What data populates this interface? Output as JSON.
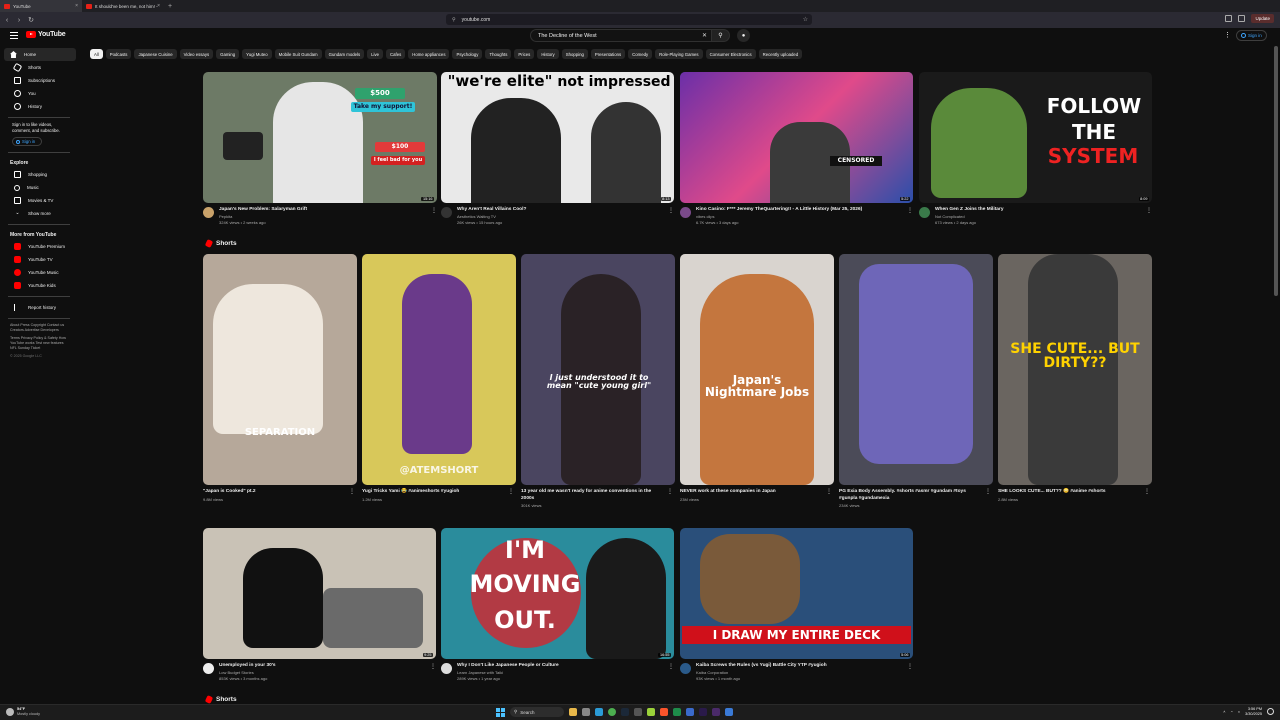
{
  "browser": {
    "tabs": [
      {
        "label": "YouTube"
      },
      {
        "label": "It should've been me, not him! - Yo..."
      }
    ],
    "url": "youtube.com",
    "update_label": "Update"
  },
  "header": {
    "logo_text": "YouTube",
    "search_value": "The Decline of the West",
    "signin_label": "Sign in"
  },
  "sidebar": {
    "main": [
      {
        "label": "Home",
        "icon": "home-icon"
      },
      {
        "label": "Shorts",
        "icon": "shorts-icon"
      },
      {
        "label": "Subscriptions",
        "icon": "subscriptions-icon"
      },
      {
        "label": "You",
        "icon": "you-icon"
      },
      {
        "label": "History",
        "icon": "history-icon"
      }
    ],
    "signin_text": "Sign in to like videos, comment, and subscribe.",
    "signin_button": "Sign in",
    "explore_title": "Explore",
    "explore": [
      {
        "label": "Shopping",
        "icon": "shopping-icon"
      },
      {
        "label": "Music",
        "icon": "music-icon"
      },
      {
        "label": "Movies & TV",
        "icon": "movies-icon"
      },
      {
        "label": "Show more",
        "icon": "chevron-down-icon"
      }
    ],
    "more_title": "More from YouTube",
    "more": [
      {
        "label": "YouTube Premium"
      },
      {
        "label": "YouTube TV"
      },
      {
        "label": "YouTube Music"
      },
      {
        "label": "YouTube Kids"
      }
    ],
    "report": "Report history",
    "footer1": "About Press Copyright Contact us Creators Advertise Developers",
    "footer2": "Terms Privacy Policy & Safety How YouTube works Test new features NFL Sunday Ticket",
    "copyright": "© 2025 Google LLC"
  },
  "chips": [
    "All",
    "Podcasts",
    "Japanese Cuisine",
    "Video essays",
    "Gaming",
    "Yugi Muteo",
    "Mobile Suit Gundam",
    "Gundam models",
    "Live",
    "Cafes",
    "Home appliances",
    "Psychology",
    "Thoughts",
    "Prices",
    "History",
    "Shopping",
    "Presentations",
    "Comedy",
    "Role-Playing Games",
    "Consumer Electronics",
    "Recently uploaded"
  ],
  "videos_row1": [
    {
      "title": "Japan's New Problem: Salaryman Grift",
      "channel": "Pepkita",
      "stats": "324K views • 2 weeks ago",
      "duration": "15:16",
      "av_color": "#c9a26a",
      "bg": "#6d7a66"
    },
    {
      "title": "Why Aren't Real Villains Cool?",
      "channel": "Aesthetics Waiting TV",
      "stats": "26K views • 15 hours ago",
      "duration": "8:13",
      "av_color": "#333",
      "bg": "#e9e9e9"
    },
    {
      "title": "Kino Casino: F*** Jeremy TheQuartering!! - A Little History (Mar 25, 2026)",
      "channel": "vibes clips",
      "stats": "6.7K views • 3 days ago",
      "duration": "5:22",
      "av_color": "#7a4a8a",
      "bg": "#3a3f8f"
    },
    {
      "title": "When Gen Z Joins the Military",
      "channel": "Not Complicated",
      "stats": "673 views • 2 days ago",
      "duration": "8:09",
      "av_color": "#3a7a4a",
      "bg": "#1a1a1a"
    }
  ],
  "overlay_text": {
    "v1_badge1": "$500",
    "v1_badge2": "Take my support!",
    "v1_badge3": "$100",
    "v1_badge4": "I feel bad for you",
    "v2_left": "\"we're elite\"",
    "v2_right": "not impressed",
    "v3_sign": "CENSORED",
    "v4_line1": "FOLLOW",
    "v4_line2": "THE",
    "v4_line3": "SYSTEM"
  },
  "shorts_title": "Shorts",
  "shorts": [
    {
      "title": "\"Japan is Cooked\" pt.2",
      "views": "9.8M views",
      "overlay": "SEPARATION",
      "bg": "#b6a89a"
    },
    {
      "title": "Yugi Tricks Yami 😂 #animeshorts #yugioh",
      "views": "1.2M views",
      "overlay": "@ATEMSHORT",
      "bg": "#d8c85a"
    },
    {
      "title": "13 year old me wasn't ready for anime conventions in the 2000s",
      "views": "301K views",
      "overlay": "I just understood it to mean \"cute young girl\"",
      "bg": "#4a4560"
    },
    {
      "title": "NEVER work at these companies in Japan",
      "views": "23M views",
      "overlay": "Japan's Nightmare Jobs",
      "bg": "#d9d4cf"
    },
    {
      "title": "PG Exia Body Assembly. #shorts #asmr #gundam #toys #gunpla #gundamexia",
      "views": "234K views",
      "overlay": "",
      "bg": "#4b4b58"
    },
    {
      "title": "SHE LOOKS CUTE... BUT?? 😳 #anime #shorts",
      "views": "2.8M views",
      "overlay": "SHE CUTE... BUT DIRTY??",
      "bg": "#6a6560"
    }
  ],
  "videos_row2": [
    {
      "title": "Unemployed in your 30's",
      "channel": "Low Budget Stories",
      "stats": "853K views • 3 months ago",
      "duration": "9:25",
      "av_color": "#eee",
      "bg": "#c9c2b6"
    },
    {
      "title": "Why I Don't Like Japanese People or Culture",
      "channel": "Learn Japanese with Taiki",
      "stats": "289K views • 1 year ago",
      "duration": "16:55",
      "av_color": "#ddd",
      "bg": "#2a8c9c"
    },
    {
      "title": "Kaiba Screws the Rules (vs Yugi) Battle City YTP #yugioh",
      "channel": "Kaiba Corporation",
      "stats": "93K views • 1 month ago",
      "duration": "5:06",
      "av_color": "#2a5a8a",
      "bg": "#2a4f7a"
    }
  ],
  "row2_overlay": {
    "v6_line1": "I'M",
    "v6_line2": "MOVING",
    "v6_line3": "OUT.",
    "v7": "I DRAW MY ENTIRE DECK"
  },
  "shorts_title_2": "Shorts",
  "taskbar": {
    "temp": "54°F",
    "weather": "Mostly cloudy",
    "search": "Search",
    "time": "3:56 PM",
    "date": "3/30/2025"
  },
  "colors": {
    "yt_red": "#ff0000",
    "link_blue": "#3ea6ff",
    "background": "#0f0f0f"
  }
}
